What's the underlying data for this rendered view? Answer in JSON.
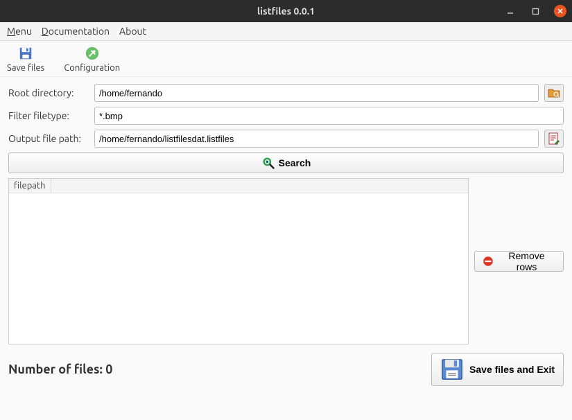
{
  "window": {
    "title": "listfiles 0.0.1"
  },
  "menubar": {
    "items": [
      "Menu",
      "Documentation",
      "About"
    ]
  },
  "toolbar": {
    "save_files_label": "Save files",
    "configuration_label": "Configuration"
  },
  "form": {
    "root_dir_label": "Root directory:",
    "root_dir_value": "/home/fernando",
    "filter_label": "Filter filetype:",
    "filter_value": "*.bmp",
    "output_label": "Output file path:",
    "output_value": "/home/fernando/listfilesdat.listfiles"
  },
  "search_button_label": "Search",
  "grid": {
    "column_header": "filepath"
  },
  "remove_rows_label": "Remove rows",
  "count": {
    "label_prefix": "Number of files: ",
    "value": "0"
  },
  "save_exit_label": "Save files and Exit"
}
